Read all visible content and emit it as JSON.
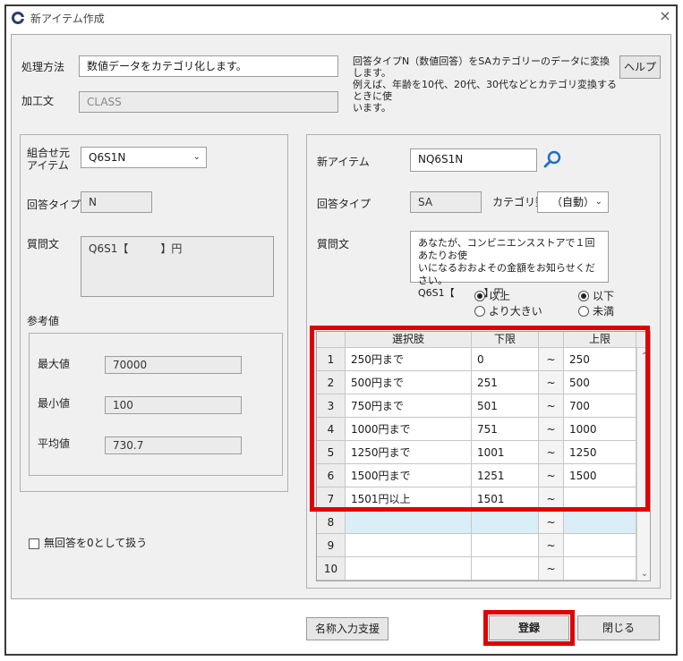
{
  "window": {
    "title": "新アイテム作成",
    "close": "×"
  },
  "top": {
    "method_label": "処理方法",
    "method_value": "数値データをカテゴリ化します。",
    "kakou_label": "加工文",
    "kakou_placeholder": "CLASS",
    "description": [
      "回答タイプN（数値回答）をSAカテゴリーのデータに変換します。",
      "例えば、年齢を10代、20代、30代などとカテゴリ変換するときに使",
      "います。"
    ],
    "help_button": "ヘルプ"
  },
  "left": {
    "source_label": [
      "組合せ元",
      "アイテム"
    ],
    "source_value": "Q6S1N",
    "answer_type_label": "回答タイプ",
    "answer_type_value": "N",
    "question_label": "質問文",
    "question_value": "Q6S1【　　　】円",
    "reference_label": "参考値",
    "max_label": "最大値",
    "max_value": "70000",
    "min_label": "最小値",
    "min_value": "100",
    "avg_label": "平均値",
    "avg_value": "730.7",
    "no_answer_checkbox": "無回答を0として扱う"
  },
  "right": {
    "new_item_label": "新アイテム",
    "new_item_value": "NQ6S1N",
    "answer_type_label": "回答タイプ",
    "answer_type_value": "SA",
    "category_count_label": "カテゴリ数",
    "category_count_value": "（自動）",
    "question_label": "質問文",
    "question_lines": [
      "あなたが、コンビニエンスストアで１回あたりお使",
      "いになるおおよその金額をお知らせください。",
      "Q6S1【　　　】円"
    ],
    "radio_lower_ge": "以上",
    "radio_lower_gt": "より大きい",
    "radio_upper_le": "以下",
    "radio_upper_lt": "未満"
  },
  "table": {
    "headers": {
      "choice": "選択肢",
      "lower": "下限",
      "upper": "上限"
    },
    "rows": [
      {
        "n": "1",
        "choice": "250円まで",
        "lower": "0",
        "tilde": "~",
        "upper": "250"
      },
      {
        "n": "2",
        "choice": "500円まで",
        "lower": "251",
        "tilde": "~",
        "upper": "500"
      },
      {
        "n": "3",
        "choice": "750円まで",
        "lower": "501",
        "tilde": "~",
        "upper": "700"
      },
      {
        "n": "4",
        "choice": "1000円まで",
        "lower": "751",
        "tilde": "~",
        "upper": "1000"
      },
      {
        "n": "5",
        "choice": "1250円まで",
        "lower": "1001",
        "tilde": "~",
        "upper": "1250"
      },
      {
        "n": "6",
        "choice": "1500円まで",
        "lower": "1251",
        "tilde": "~",
        "upper": "1500"
      },
      {
        "n": "7",
        "choice": "1501円以上",
        "lower": "1501",
        "tilde": "~",
        "upper": ""
      },
      {
        "n": "8",
        "choice": "",
        "lower": "",
        "tilde": "~",
        "upper": ""
      },
      {
        "n": "9",
        "choice": "",
        "lower": "",
        "tilde": "~",
        "upper": ""
      },
      {
        "n": "10",
        "choice": "",
        "lower": "",
        "tilde": "~",
        "upper": ""
      }
    ]
  },
  "footer": {
    "name_assist_button": "名称入力支援",
    "register_button": "登録",
    "close_button": "閉じる"
  },
  "colors": {
    "highlight": "#e00000",
    "new_row": "#daeef8",
    "search_icon": "#1f6fc5"
  }
}
